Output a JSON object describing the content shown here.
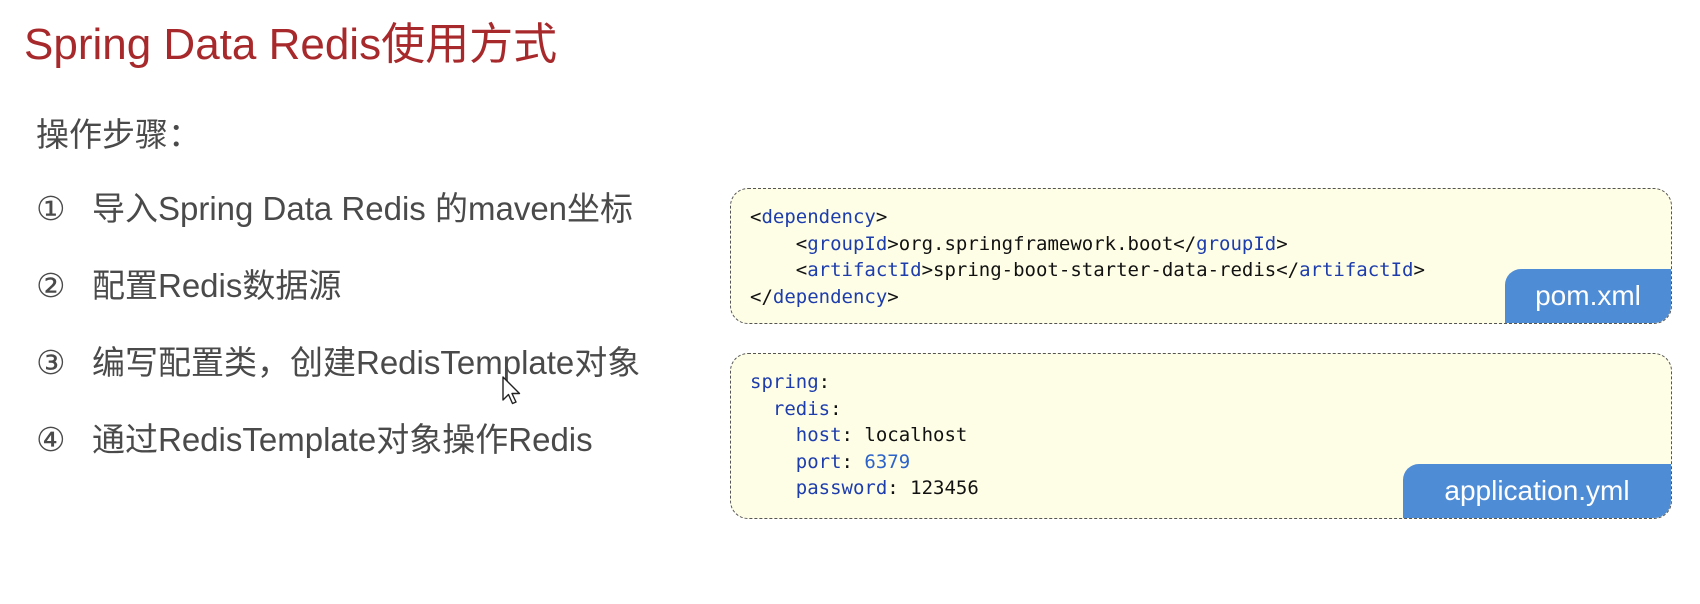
{
  "title": "Spring Data Redis使用方式",
  "subtitle": "操作步骤：",
  "steps": [
    {
      "num": "①",
      "text": "导入Spring Data Redis 的maven坐标"
    },
    {
      "num": "②",
      "text": "配置Redis数据源"
    },
    {
      "num": "③",
      "text": "编写配置类，创建RedisTemplate对象"
    },
    {
      "num": "④",
      "text": "通过RedisTemplate对象操作Redis"
    }
  ],
  "pom": {
    "label": "pom.xml",
    "dependency_tag": "dependency",
    "group_tag": "groupId",
    "group_value": "org.springframework.boot",
    "artifact_tag": "artifactId",
    "artifact_value": "spring-boot-starter-data-redis"
  },
  "yml": {
    "label": "application.yml",
    "spring_key": "spring",
    "redis_key": "redis",
    "host_key": "host",
    "host_value": "localhost",
    "port_key": "port",
    "port_value": "6379",
    "password_key": "password",
    "password_value": "123456"
  },
  "colors": {
    "title": "#a8292b",
    "code_bg": "#fefde6",
    "label_bg": "#4f8cd6",
    "xml_tag": "#1d3dac"
  }
}
